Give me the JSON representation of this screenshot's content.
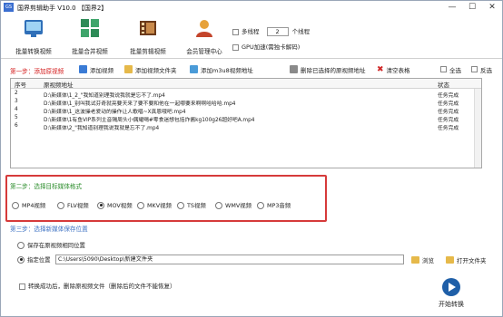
{
  "title": "国界剪辑助手 V10.0 【国界2】",
  "app_icon_text": "GS",
  "window_controls": {
    "minimize": "—",
    "maximize": "☐",
    "close": "✕"
  },
  "toolbar": {
    "buttons": [
      {
        "label": "批量转换视频"
      },
      {
        "label": "批量合并视频"
      },
      {
        "label": "批量剪辑视频"
      },
      {
        "label": "会员管理中心"
      }
    ],
    "multithread_label": "多线程",
    "thread_count": "2",
    "thread_unit": "个线程",
    "gpu_label": "GPU加速(需独卡解码)"
  },
  "step1": {
    "label": "第一步：添加原视频",
    "add_video": "添加视频",
    "add_folder": "添加视频文件夹",
    "add_m3u8": "添加m3u8视频地址",
    "delete_selected": "删除已选择的原视频地址",
    "clear_table": "清空表格",
    "select_all": "全选",
    "invert": "反选"
  },
  "table": {
    "columns": [
      "序号",
      "原视频地址",
      "状态"
    ],
    "rows": [
      {
        "no": "2",
        "path": "D:\\新媒体\\1_2_\"我知道别理我说我就是忘不了.mp4",
        "status": "任务完成"
      },
      {
        "no": "3",
        "path": "D:\\新媒体\\1_别叫我试芬奇就亮要天来了要不要和他在一起哪要来啊啊哈哈哈.mp4",
        "status": "任务完成"
      },
      {
        "no": "4",
        "path": "D:\\新媒体\\1_这波操老爱动的操作让人歌唱~X真恩哦吧.mp4",
        "status": "任务完成"
      },
      {
        "no": "5",
        "path": "D:\\新媒体\\1有鱼VIP系列主音隔周头小偶耀喝#零食迷想包括炸酱kg100g26超好吧A.mp4",
        "status": "任务完成"
      },
      {
        "no": "6",
        "path": "D:\\新媒体\\2_\"我知道别理我说我就是忘不了.mp4",
        "status": "任务完成"
      }
    ]
  },
  "step2": {
    "label": "第二步：选择目标媒体格式",
    "formats": [
      "MP4视频",
      "FLV视频",
      "MOV视频",
      "MKV视频",
      "TS视频",
      "WMV视频",
      "MP3音频"
    ],
    "selected_index": 2
  },
  "step3": {
    "label": "第三步：选择新媒体保存位置",
    "same_location": "保存在原视频相同位置",
    "specify": "指定位置",
    "path": "C:\\Users\\5090\\Desktop\\新建文件夹",
    "browse": "浏览",
    "open_folder": "打开文件夹"
  },
  "delete_after": "转换成功后，删除原视频文件（删除后的文件不能恢复）",
  "start_button": "开始转换"
}
